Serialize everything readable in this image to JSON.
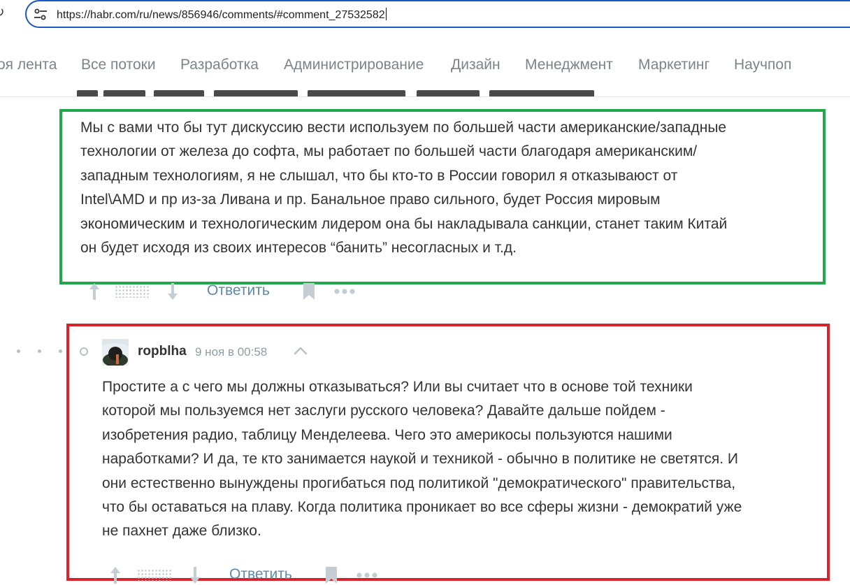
{
  "browser": {
    "url": "https://habr.com/ru/news/856946/comments/#comment_27532582"
  },
  "nav": {
    "items": [
      "оя лента",
      "Все потоки",
      "Разработка",
      "Администрирование",
      "Дизайн",
      "Менеджмент",
      "Маркетинг",
      "Научпоп"
    ]
  },
  "comment1": {
    "lines": [
      "Мы с вами что бы тут дискуссию вести используем по большей части американские/западные",
      "технологии от железа до софта, мы работает по большей части благодаря американским/",
      "западным технологиям, я не слышал, что бы кто-то в России говорил я отказываюст от",
      "Intel\\AMD и пр из-за Ливана и пр. Банальное право сильного, будет Россия мировым",
      "экономическим и технологическим лидером она бы накладывала санкции, станет таким Китай",
      "он будет исходя из своих интересов “банить” несогласных и т.д."
    ],
    "reply_label": "Ответить"
  },
  "comment2": {
    "author": "ropblha",
    "date": "9 ноя в 00:58",
    "lines": [
      "Простите а с чего мы должны отказываться? Или вы считает что в основе той техники",
      "которой мы пользуемся нет заслуги русского человека? Давайте дальше пойдем -",
      "изобретения радио, таблицу Менделеева. Чего это америкосы пользуются нашими",
      "наработками? И да, те кто занимается наукой и техникой - обычно в политике не светятся. И",
      "они естественно вынуждены прогибаться под политикой \"демократического\" правительства,",
      "что бы оставаться на плаву. Когда политика проникает во все сферы жизни - демократий уже",
      "не пахнет даже близко."
    ],
    "reply_label": "Ответить"
  },
  "colors": {
    "highlight_green": "#22a84a",
    "highlight_red": "#d9232c",
    "url_border": "#1a56c6",
    "reply_link": "#5e89a8"
  },
  "icons": {
    "reload": "reload-icon",
    "site_info": "tune-icon",
    "vote_up": "arrow-up-icon",
    "vote_down": "arrow-down-icon",
    "bookmark": "bookmark-icon",
    "more": "more-dots-icon",
    "collapse": "chevron-up-icon"
  }
}
